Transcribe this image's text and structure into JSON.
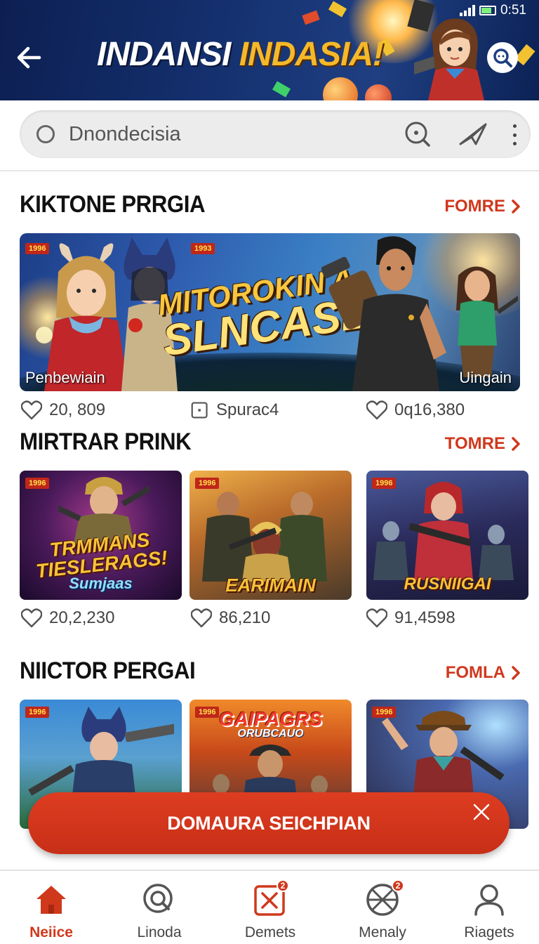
{
  "status_bar": {
    "time": "0:51"
  },
  "header": {
    "title_part1": "INDANSI",
    "title_part2": "INDASIA!"
  },
  "search": {
    "placeholder": "Dnondecisia"
  },
  "sections": [
    {
      "title": "KIKTONE PRRGIA",
      "more": "FOMRE",
      "banner": {
        "title_line1": "MITOROKIN A",
        "title_line2": "SLNCASL!",
        "caption_left": "Penbewiain",
        "caption_right": "Uingain",
        "tag_left": "1996",
        "tag_mid": "1993"
      },
      "stats": [
        {
          "icon": "heart-icon",
          "value": "20, 809"
        },
        {
          "icon": "square-icon",
          "value": "Spurac4"
        },
        {
          "icon": "heart-icon",
          "value": "0q16,380"
        }
      ]
    },
    {
      "title": "MIRTRAR PRINK",
      "more": "TOMRE",
      "thumbs": [
        {
          "tag": "1996",
          "title": "TRMMANS\nTIESLERAGS!",
          "subtitle": "Sumjaas",
          "likes": "20,2,230"
        },
        {
          "tag": "1996",
          "title": "EARIMAIN",
          "likes": "86,210"
        },
        {
          "tag": "1996",
          "title": "RUSNIIGAI",
          "likes": "91,4598"
        }
      ]
    },
    {
      "title": "NIICTOR PERGAI",
      "more": "FOMLA",
      "thumbs": [
        {
          "tag": "1996",
          "title": ""
        },
        {
          "tag": "1996",
          "title": "GAIPAGRS",
          "subtitle": "ORUBCAUO"
        },
        {
          "tag": "1996",
          "title": ""
        }
      ]
    }
  ],
  "toast": {
    "label": "DOMAURA SEICHPIAN"
  },
  "bottom_nav": [
    {
      "label": "Neiice",
      "icon": "home-icon",
      "active": true
    },
    {
      "label": "Linoda",
      "icon": "search-icon",
      "active": false
    },
    {
      "label": "Demets",
      "icon": "box-x-icon",
      "active": false,
      "badge": "2"
    },
    {
      "label": "Menaly",
      "icon": "globe-x-icon",
      "active": false,
      "badge": "2"
    },
    {
      "label": "Riagets",
      "icon": "person-icon",
      "active": false
    }
  ],
  "colors": {
    "accent": "#d0381c",
    "header_bg": "#14306e",
    "title_gold": "#f4b92a"
  }
}
